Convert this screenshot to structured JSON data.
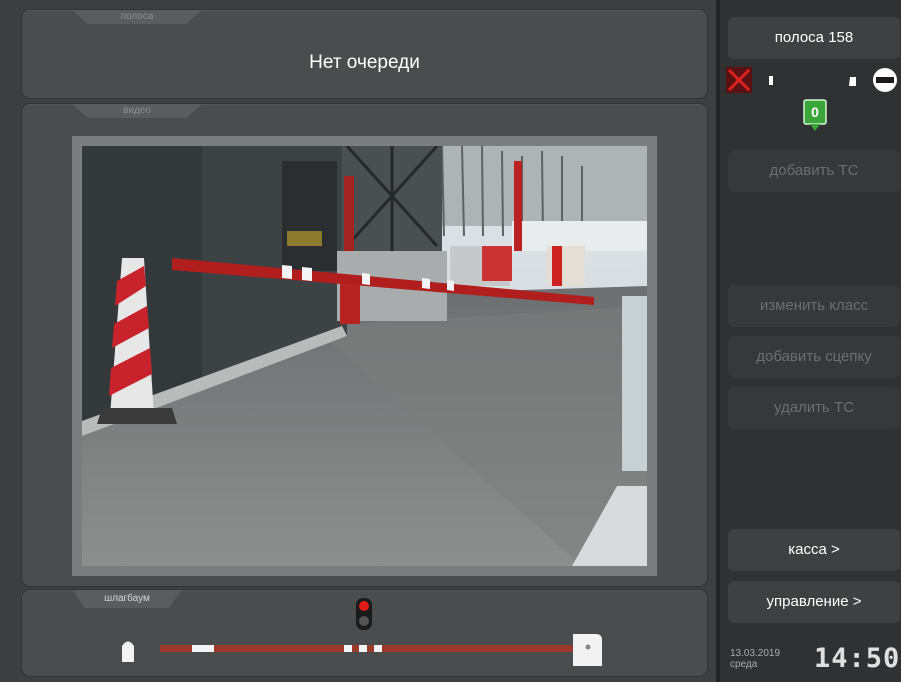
{
  "lane_panel": {
    "tab_label": "полоса",
    "status_text": "Нет очереди"
  },
  "video_panel": {
    "tab_label": "видео"
  },
  "barrier_panel": {
    "tab_label": "шлагбаум"
  },
  "sidebar": {
    "lane_button": "полоса 158",
    "queue_count": "0",
    "add_vehicle": "добавить ТС",
    "change_class": "изменить класс",
    "add_trailer": "добавить сцепку",
    "delete_vehicle": "удалить ТС",
    "cashier": "касса >",
    "control": "управление >"
  },
  "footer": {
    "date": "13.03.2019",
    "weekday": "среда",
    "time": "14:50"
  },
  "colors": {
    "accent_green": "#3aa63a",
    "alert_red": "#cc1f1f",
    "barrier_red": "#9b3a2a"
  }
}
